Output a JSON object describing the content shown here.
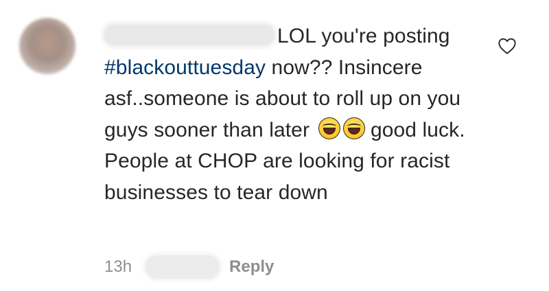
{
  "comment": {
    "text_before_hashtag": "LOL you're posting",
    "hashtag": "#blackouttuesday",
    "text_after_hashtag": " now?? Insincere asf..someone is about to roll up on you guys sooner than later",
    "text_after_emoji": " good luck. People at CHOP are looking for racist businesses to tear down",
    "emojis": [
      "face-with-tears-of-joy-emoji",
      "face-with-tears-of-joy-emoji"
    ],
    "time": "13h",
    "reply_label": "Reply"
  },
  "icons": {
    "like": "heart-outline-icon"
  },
  "colors": {
    "text": "#262626",
    "hashtag": "#00376b",
    "meta": "#8e8e8e"
  }
}
